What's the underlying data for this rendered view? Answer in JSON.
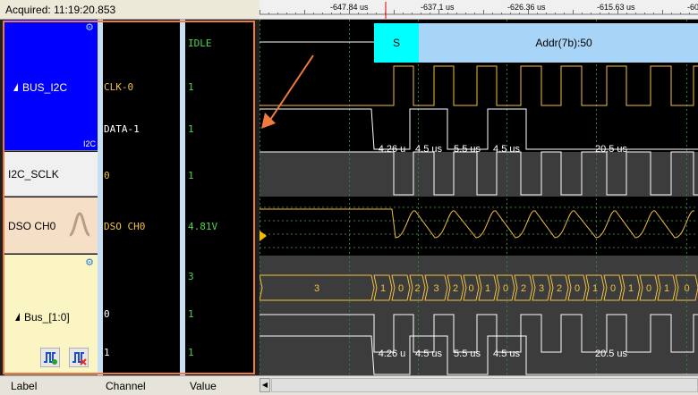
{
  "header": {
    "acquired": "Acquired: 11:19:20.853"
  },
  "timebar": {
    "ticks": [
      "-647.84 us",
      "-637.1 us",
      "-626.36 us",
      "-615.63 us",
      "-60"
    ]
  },
  "groups": {
    "bus_i2c": {
      "label": "BUS_I2C",
      "sub": "I2C"
    },
    "sclk": {
      "label": "I2C_SCLK"
    },
    "dso": {
      "label": "DSO CH0"
    },
    "bus10": {
      "label": "Bus_[1:0]"
    }
  },
  "channels": {
    "clk": "CLK-0",
    "data": "DATA-1",
    "sclk": "0",
    "dso": "DSO CH0",
    "b0": "0",
    "b1": "1"
  },
  "values": {
    "idle": "IDLE",
    "clk": "1",
    "data": "1",
    "sclk": "1",
    "dso": "4.81V",
    "bus": "3",
    "b0": "1",
    "b1": "1"
  },
  "waveform": {
    "start_label": "S",
    "addr_label": "Addr(7b):50",
    "data_widths": [
      "4.26 u",
      "4.5 us",
      "5.5 us",
      "4.5 us",
      "20.5 us"
    ],
    "bus_values": [
      "3",
      "1",
      "0",
      "2",
      "3",
      "2",
      "0",
      "1",
      "0",
      "2",
      "3",
      "2",
      "0",
      "1",
      "0",
      "1",
      "0",
      "1",
      "0",
      "1"
    ],
    "bot_widths": [
      "4.26 u",
      "4.5 us",
      "5.5 us",
      "4.5 us",
      "20.5 us"
    ]
  },
  "footer": {
    "label": "Label",
    "channel": "Channel",
    "value": "Value"
  },
  "colors": {
    "selection": "#f07a3c",
    "trace": "#f0c040",
    "cyan": "#00ffff",
    "addr": "#a8d4f8"
  }
}
